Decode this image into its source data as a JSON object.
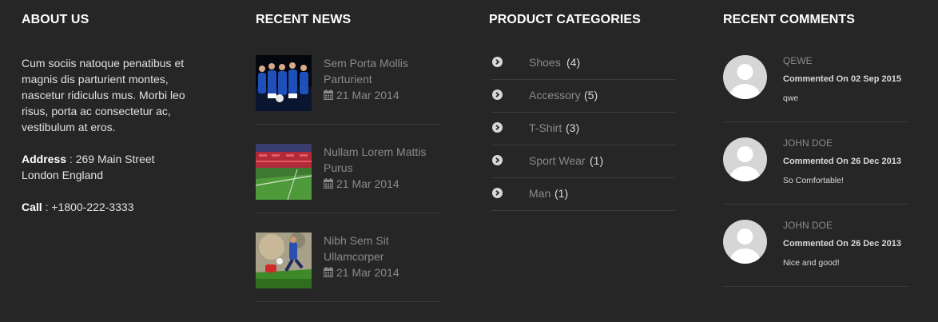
{
  "about": {
    "heading": "ABOUT US",
    "text": "Cum sociis natoque penatibus et magnis dis parturient montes, nascetur ridiculus mus. Morbi leo risus, porta ac consectetur ac, vestibulum at eros.",
    "address_label": "Address",
    "address_line1": "269 Main Street",
    "address_line2": "London England",
    "call_label": "Call",
    "call_value": "+1800-222-3333"
  },
  "news": {
    "heading": "RECENT NEWS",
    "items": [
      {
        "title": "Sem Porta Mollis Parturient",
        "date": "21 Mar 2014",
        "icon": "calendar-icon"
      },
      {
        "title": "Nullam Lorem Mattis Purus",
        "date": "21 Mar 2014",
        "icon": "calendar-icon"
      },
      {
        "title": "Nibh Sem Sit Ullamcorper",
        "date": "21 Mar 2014",
        "icon": "calendar-icon"
      }
    ]
  },
  "categories": {
    "heading": "PRODUCT CATEGORIES",
    "items": [
      {
        "label": "Shoes",
        "count": "(4)"
      },
      {
        "label": "Accessory",
        "count": "(5)"
      },
      {
        "label": "T-Shirt",
        "count": "(3)"
      },
      {
        "label": "Sport Wear",
        "count": "(1)"
      },
      {
        "label": "Man",
        "count": "(1)"
      }
    ]
  },
  "comments": {
    "heading": "RECENT COMMENTS",
    "items": [
      {
        "name": "QEWE",
        "meta": "Commented On 02 Sep 2015",
        "text": "qwe"
      },
      {
        "name": "JOHN DOE",
        "meta": "Commented On 26 Dec 2013",
        "text": "So Comfortable!"
      },
      {
        "name": "JOHN DOE",
        "meta": "Commented On 26 Dec 2013",
        "text": "Nice and good!"
      }
    ]
  },
  "colors": {
    "background": "#262626",
    "heading": "#ffffff",
    "muted_link": "#8a8a8a",
    "divider": "#3c3c3c"
  }
}
